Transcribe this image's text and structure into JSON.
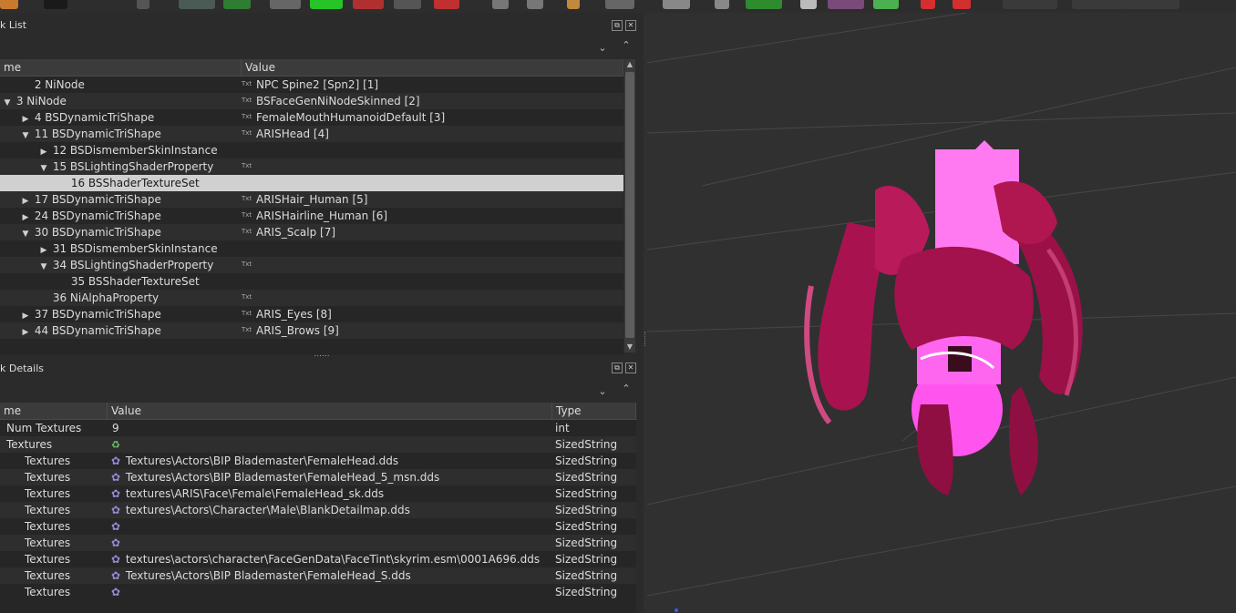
{
  "toolbar": {
    "buttons": [
      {
        "icon": "brush-icon",
        "color": "#c87b2c"
      },
      {
        "icon": "color-swatch-icon",
        "color": "#1a1a1a"
      },
      {
        "icon": "pointer-icon",
        "color": "#555555"
      },
      {
        "icon": "select-tool-icon",
        "color": "#4a5a55"
      },
      {
        "icon": "link-icon",
        "color": "#2e7d32"
      },
      {
        "icon": "box-gray-icon",
        "color": "#666666"
      },
      {
        "icon": "box-green-icon",
        "color": "#27c427"
      },
      {
        "icon": "box-red-icon",
        "color": "#b03030"
      },
      {
        "icon": "box-dark-icon",
        "color": "#555555"
      },
      {
        "icon": "cube-rgb-icon",
        "color": "#c03030"
      },
      {
        "icon": "brush-small-icon",
        "color": "#777777"
      },
      {
        "icon": "circle-icon",
        "color": "#777777"
      },
      {
        "icon": "pen-icon",
        "color": "#c08a3a"
      },
      {
        "icon": "keyboard-icon",
        "color": "#666666"
      },
      {
        "icon": "helmet-icon",
        "color": "#888888"
      },
      {
        "icon": "bone-icon",
        "color": "#888888"
      },
      {
        "icon": "green-shape-icon",
        "color": "#2e8b2e"
      },
      {
        "icon": "lock-icon",
        "color": "#bbbbbb"
      },
      {
        "icon": "texture-icon",
        "color": "#7a4a7a"
      },
      {
        "icon": "green-circle-icon",
        "color": "#4caf50"
      },
      {
        "icon": "red-marker-icon",
        "color": "#d32f2f"
      },
      {
        "icon": "red-marker-2-icon",
        "color": "#d32f2f"
      }
    ]
  },
  "block_list": {
    "title": "k List",
    "columns": {
      "name": "me",
      "value": "Value"
    },
    "rows": [
      {
        "name": "2 NiNode",
        "value": "NPC Spine2 [Spn2] [1]",
        "txt": true,
        "arrow": ""
      },
      {
        "name": "3 NiNode",
        "value": "BSFaceGenNiNodeSkinned [2]",
        "txt": true,
        "arrow": "▼"
      },
      {
        "name": "4 BSDynamicTriShape",
        "value": "FemaleMouthHumanoidDefault [3]",
        "txt": true,
        "arrow": "▶"
      },
      {
        "name": "11 BSDynamicTriShape",
        "value": "ARISHead [4]",
        "txt": true,
        "arrow": "▼"
      },
      {
        "name": "12 BSDismemberSkinInstance",
        "value": "",
        "txt": false,
        "arrow": "▶"
      },
      {
        "name": "15 BSLightingShaderProperty",
        "value": "",
        "txt": true,
        "arrow": "▼"
      },
      {
        "name": "16 BSShaderTextureSet",
        "value": "",
        "txt": false,
        "arrow": ""
      },
      {
        "name": "17 BSDynamicTriShape",
        "value": "ARISHair_Human [5]",
        "txt": true,
        "arrow": "▶"
      },
      {
        "name": "24 BSDynamicTriShape",
        "value": "ARISHairline_Human [6]",
        "txt": true,
        "arrow": "▶"
      },
      {
        "name": "30 BSDynamicTriShape",
        "value": "ARIS_Scalp [7]",
        "txt": true,
        "arrow": "▼"
      },
      {
        "name": "31 BSDismemberSkinInstance",
        "value": "",
        "txt": false,
        "arrow": "▶"
      },
      {
        "name": "34 BSLightingShaderProperty",
        "value": "",
        "txt": true,
        "arrow": "▼"
      },
      {
        "name": "35 BSShaderTextureSet",
        "value": "",
        "txt": false,
        "arrow": ""
      },
      {
        "name": "36 NiAlphaProperty",
        "value": "",
        "txt": true,
        "arrow": ""
      },
      {
        "name": "37 BSDynamicTriShape",
        "value": "ARIS_Eyes [8]",
        "txt": true,
        "arrow": "▶"
      },
      {
        "name": "44 BSDynamicTriShape",
        "value": "ARIS_Brows [9]",
        "txt": true,
        "arrow": "▶"
      }
    ],
    "txt_label": "Txt",
    "splitter_grip": "......"
  },
  "block_details": {
    "title": "k Details",
    "columns": {
      "name": "me",
      "value": "Value",
      "type": "Type"
    },
    "rows": [
      {
        "name": "Num Textures",
        "value": "9",
        "type": "int",
        "icon": ""
      },
      {
        "name": "Textures",
        "value": "",
        "type": "SizedString",
        "icon": "recycle"
      },
      {
        "name": "Textures",
        "value": "Textures\\Actors\\BIP Blademaster\\FemaleHead.dds",
        "type": "SizedString",
        "icon": "gear"
      },
      {
        "name": "Textures",
        "value": "Textures\\Actors\\BIP Blademaster\\FemaleHead_5_msn.dds",
        "type": "SizedString",
        "icon": "gear"
      },
      {
        "name": "Textures",
        "value": "textures\\ARIS\\Face\\Female\\FemaleHead_sk.dds",
        "type": "SizedString",
        "icon": "gear"
      },
      {
        "name": "Textures",
        "value": "textures\\Actors\\Character\\Male\\BlankDetailmap.dds",
        "type": "SizedString",
        "icon": "gear"
      },
      {
        "name": "Textures",
        "value": "",
        "type": "SizedString",
        "icon": "gear"
      },
      {
        "name": "Textures",
        "value": "",
        "type": "SizedString",
        "icon": "gear"
      },
      {
        "name": "Textures",
        "value": "textures\\actors\\character\\FaceGenData\\FaceTint\\skyrim.esm\\0001A696.dds",
        "type": "SizedString",
        "icon": "gear"
      },
      {
        "name": "Textures",
        "value": "Textures\\Actors\\BIP Blademaster\\FemaleHead_S.dds",
        "type": "SizedString",
        "icon": "gear"
      },
      {
        "name": "Textures",
        "value": "",
        "type": "SizedString",
        "icon": "gear"
      }
    ]
  },
  "colors": {
    "selection": "#d0d0d0",
    "hair": "#a8134f",
    "head": "#ff66f0"
  }
}
